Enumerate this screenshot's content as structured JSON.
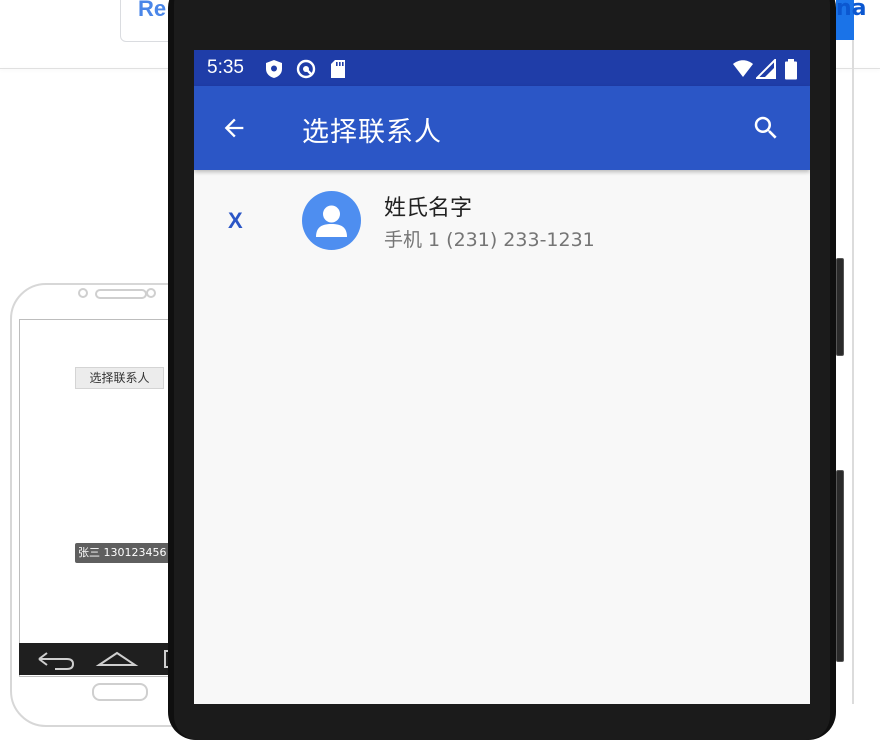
{
  "background": {
    "card_label": "Re",
    "right_button_label": "na",
    "wireframe": {
      "title": "选择联系人",
      "row": "张三 130123456"
    }
  },
  "status_bar": {
    "time": "5:35",
    "icons": [
      "shield-icon",
      "at-sign-icon",
      "sd-card-icon",
      "wifi-icon",
      "signal-icon",
      "battery-icon"
    ]
  },
  "app_bar": {
    "title": "选择联系人",
    "back_icon": "arrow-back-icon",
    "search_icon": "search-icon",
    "color": "#2b56c6",
    "status_color": "#1f3da8"
  },
  "contacts": [
    {
      "remove_label": "X",
      "name": "姓氏名字",
      "phone": "手机 1 (231) 233-1231",
      "avatar_color": "#4e8ef0"
    }
  ]
}
